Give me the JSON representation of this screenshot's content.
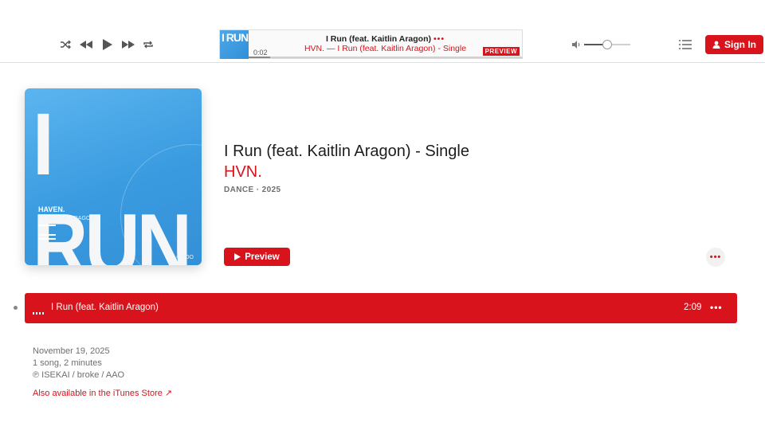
{
  "player": {
    "controls": [
      "shuffle-icon",
      "previous-icon",
      "play-icon",
      "next-icon",
      "repeat-icon"
    ],
    "lcd": {
      "art_text": "I RUN",
      "title": "I Run (feat. Kaitlin Aragon)",
      "title_more": "•••",
      "subtitle": "HVN. — I Run (feat. Kaitlin Aragon) - Single",
      "elapsed": "0:02",
      "badge": "PREVIEW",
      "progress": 0.08
    },
    "volume_level": 0.5,
    "sign_in_label": "Sign In"
  },
  "album": {
    "artwork": {
      "big_text": "I RUN",
      "artist_text": "HAVEN.",
      "feat_text": "FT. KAITLIN.ARAGON",
      "corner_text": "× OOO"
    },
    "title": "I Run (feat. Kaitlin Aragon) - Single",
    "artist": "HVN.",
    "meta": "DANCE · 2025",
    "preview_label": "Preview",
    "more_label": "•••"
  },
  "tracks": [
    {
      "title": "I Run (feat. Kaitlin Aragon)",
      "duration": "2:09",
      "more": "•••"
    }
  ],
  "info": {
    "release_date": "November 19, 2025",
    "summary": "1 song, 2 minutes",
    "copyright": "℗ ISEKAI / broke / AAO",
    "itunes_link": "Also available in the iTunes Store ↗"
  },
  "colors": {
    "accent": "#d8131b",
    "text_secondary": "#6e6e73",
    "artwork_blue": "#3a9be0"
  }
}
